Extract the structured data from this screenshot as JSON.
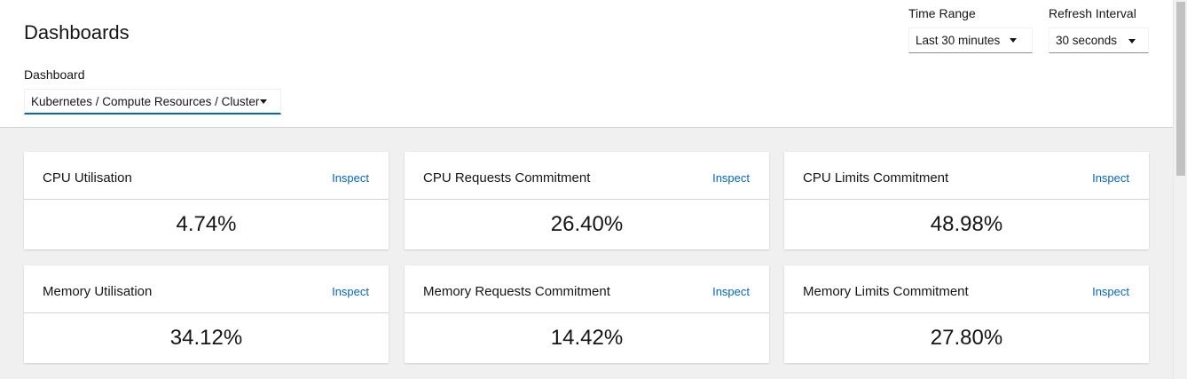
{
  "header": {
    "title": "Dashboards",
    "dashboard_label": "Dashboard",
    "dashboard_value": "Kubernetes / Compute Resources / Cluster",
    "time_range_label": "Time Range",
    "time_range_value": "Last 30 minutes",
    "refresh_label": "Refresh Interval",
    "refresh_value": "30 seconds"
  },
  "cards": [
    {
      "title": "CPU Utilisation",
      "link": "Inspect",
      "value": "4.74%"
    },
    {
      "title": "CPU Requests Commitment",
      "link": "Inspect",
      "value": "26.40%"
    },
    {
      "title": "CPU Limits Commitment",
      "link": "Inspect",
      "value": "48.98%"
    },
    {
      "title": "Memory Utilisation",
      "link": "Inspect",
      "value": "34.12%"
    },
    {
      "title": "Memory Requests Commitment",
      "link": "Inspect",
      "value": "14.42%"
    },
    {
      "title": "Memory Limits Commitment",
      "link": "Inspect",
      "value": "27.80%"
    }
  ],
  "colors": {
    "link": "#0066cc",
    "background": "#f0f0f0",
    "card": "#ffffff"
  }
}
